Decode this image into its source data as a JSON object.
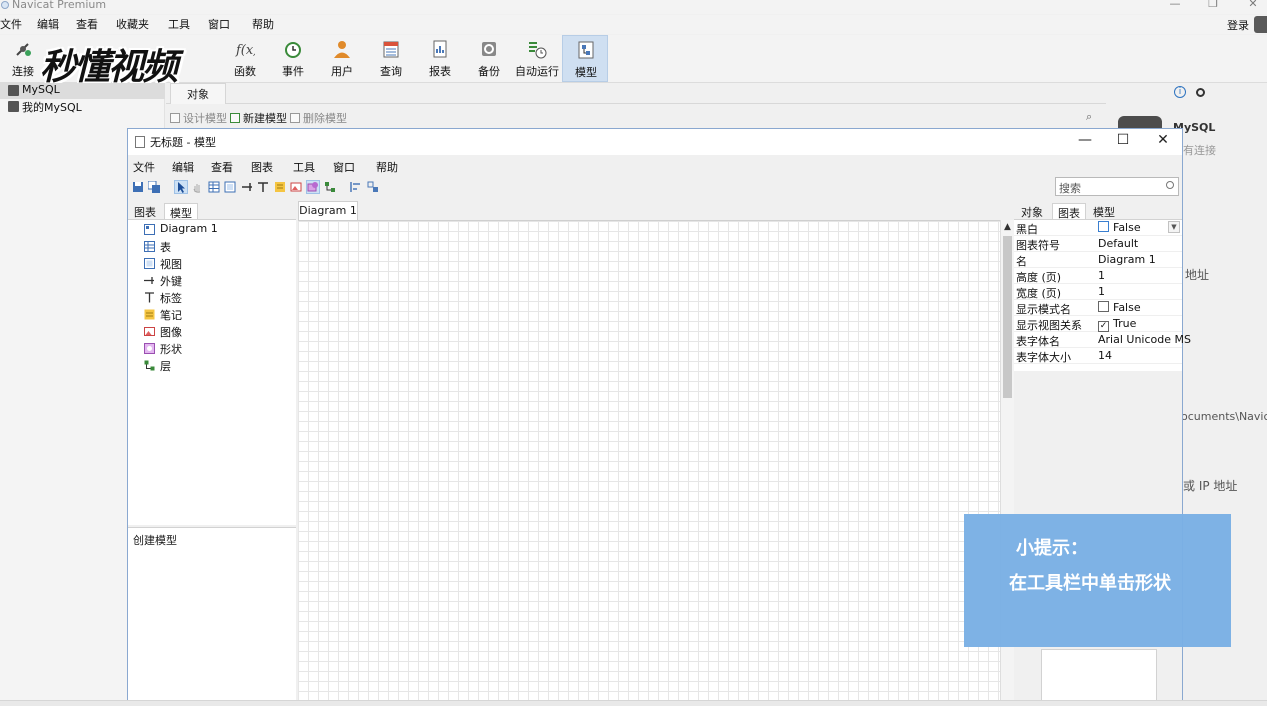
{
  "main_window": {
    "title": "Navicat Premium",
    "menu": [
      "文件",
      "编辑",
      "查看",
      "收藏夹",
      "工具",
      "窗口",
      "帮助"
    ],
    "login_label": "登录",
    "toolbar": [
      {
        "label": "连接",
        "icon": "plug-icon"
      },
      {
        "label": "函数",
        "icon": "function-icon"
      },
      {
        "label": "事件",
        "icon": "clock-icon"
      },
      {
        "label": "用户",
        "icon": "user-icon"
      },
      {
        "label": "查询",
        "icon": "query-icon"
      },
      {
        "label": "报表",
        "icon": "report-icon"
      },
      {
        "label": "备份",
        "icon": "backup-icon"
      },
      {
        "label": "自动运行",
        "icon": "schedule-icon"
      },
      {
        "label": "模型",
        "icon": "model-icon",
        "active": true
      }
    ],
    "watermark": "秒懂视频",
    "nav": [
      "MySQL",
      "我的MySQL"
    ],
    "object_tab": "对象",
    "object_actions": [
      "设计模型",
      "新建模型",
      "删除模型"
    ],
    "info_panel": {
      "name": "MySQL",
      "status_fragment": "有连接",
      "fragments": [
        "地址",
        "ocuments\\Navica",
        "或 IP 地址"
      ]
    }
  },
  "model_window": {
    "title": "无标题 - 模型",
    "menu": [
      "文件",
      "编辑",
      "查看",
      "图表",
      "工具",
      "窗口",
      "帮助"
    ],
    "search_placeholder": "搜索",
    "left_tabs": [
      "图表",
      "模型"
    ],
    "tree": [
      {
        "label": "Diagram 1",
        "icon": "diagram-icon"
      },
      {
        "label": "表",
        "icon": "table-icon"
      },
      {
        "label": "视图",
        "icon": "view-icon"
      },
      {
        "label": "外键",
        "icon": "foreign-key-icon"
      },
      {
        "label": "标签",
        "icon": "label-icon"
      },
      {
        "label": "笔记",
        "icon": "note-icon"
      },
      {
        "label": "图像",
        "icon": "image-icon"
      },
      {
        "label": "形状",
        "icon": "shape-icon"
      },
      {
        "label": "层",
        "icon": "layer-icon"
      }
    ],
    "description": "创建模型",
    "canvas_tab": "Diagram 1",
    "prop_tabs": [
      "对象",
      "图表",
      "模型"
    ],
    "properties": [
      {
        "key": "黑白",
        "value": "False",
        "checkbox": true,
        "checked": false
      },
      {
        "key": "图表符号",
        "value": "Default"
      },
      {
        "key": "名",
        "value": "Diagram 1"
      },
      {
        "key": "高度 (页)",
        "value": "1"
      },
      {
        "key": "宽度 (页)",
        "value": "1"
      },
      {
        "key": "显示模式名",
        "value": "False",
        "checkbox": true,
        "checked": false
      },
      {
        "key": "显示视图关系",
        "value": "True",
        "checkbox": true,
        "checked": true
      },
      {
        "key": "表字体名",
        "value": "Arial Unicode MS"
      },
      {
        "key": "表字体大小",
        "value": "14"
      }
    ]
  },
  "hint": {
    "title": "小提示：",
    "body": "在工具栏中单击形状"
  },
  "colors": {
    "accent": "#2f74c0",
    "hint_bg": "#7ab0e4",
    "active_tool": "#cfdff1"
  }
}
